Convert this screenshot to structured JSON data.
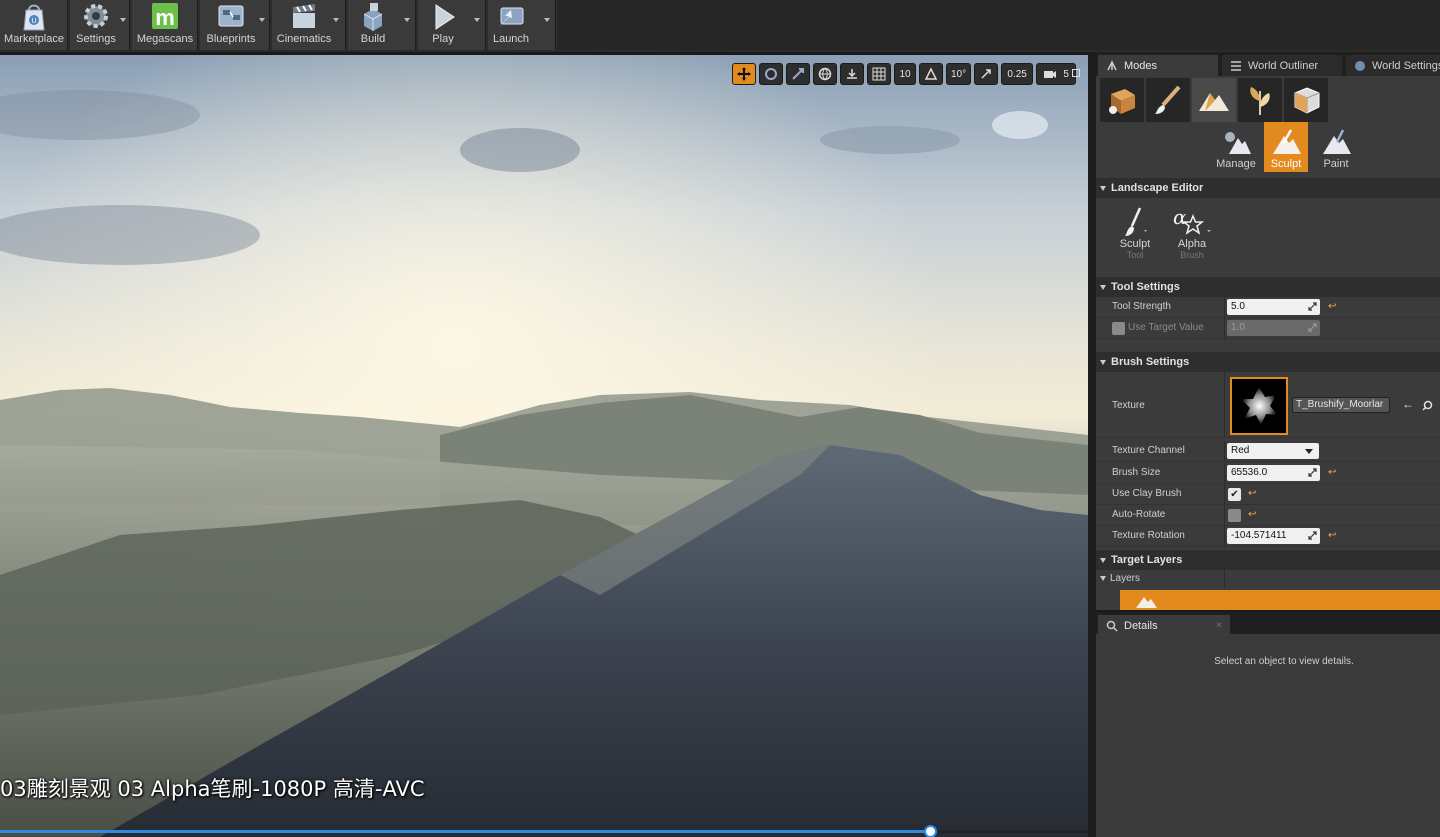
{
  "toolbar": {
    "items": [
      {
        "label": "Marketplace",
        "icon": "marketplace-icon"
      },
      {
        "label": "Settings",
        "icon": "settings-icon"
      },
      {
        "label": "Megascans",
        "icon": "megascans-icon"
      },
      {
        "label": "Blueprints",
        "icon": "blueprints-icon"
      },
      {
        "label": "Cinematics",
        "icon": "cinematics-icon"
      },
      {
        "label": "Build",
        "icon": "build-icon"
      },
      {
        "label": "Play",
        "icon": "play-icon"
      },
      {
        "label": "Launch",
        "icon": "launch-icon"
      }
    ]
  },
  "viewport": {
    "toolbar": {
      "grid_snap": "10",
      "rotation_snap": "10°",
      "scale_snap": "0.25",
      "camera_speed": "5"
    },
    "subtitle": "03雕刻景观 03 Alpha笔刷-1080P 高清-AVC",
    "progress": 0.855
  },
  "tabs": {
    "modes": "Modes",
    "world_outliner": "World Outliner",
    "world_settings": "World Settings",
    "details": "Details"
  },
  "landscape_tools": {
    "manage": "Manage",
    "sculpt": "Sculpt",
    "paint": "Paint"
  },
  "landscape_editor": {
    "header": "Landscape Editor",
    "sculpt_tool_label": "Sculpt",
    "sculpt_tool_sub": "Tool",
    "alpha_brush_label": "Alpha",
    "alpha_brush_sub": "Brush"
  },
  "tool_settings": {
    "header": "Tool Settings",
    "tool_strength_label": "Tool Strength",
    "tool_strength_value": "5.0",
    "use_target_value_label": "Use Target Value",
    "target_value": "1.0"
  },
  "brush_settings": {
    "header": "Brush Settings",
    "texture_label": "Texture",
    "texture_asset": "T_Brushify_Moorlar",
    "texture_channel_label": "Texture Channel",
    "texture_channel_value": "Red",
    "brush_size_label": "Brush Size",
    "brush_size_value": "65536.0",
    "use_clay_brush_label": "Use Clay Brush",
    "use_clay_brush": true,
    "auto_rotate_label": "Auto-Rotate",
    "auto_rotate": false,
    "texture_rotation_label": "Texture Rotation",
    "texture_rotation_value": "-104.571411"
  },
  "target_layers": {
    "header": "Target Layers",
    "layers_label": "Layers"
  },
  "details": {
    "message": "Select an object to view details."
  },
  "colors": {
    "accent": "#e38a1f",
    "panel_bg": "#3b3b3b",
    "progress": "#2c8ce0"
  }
}
